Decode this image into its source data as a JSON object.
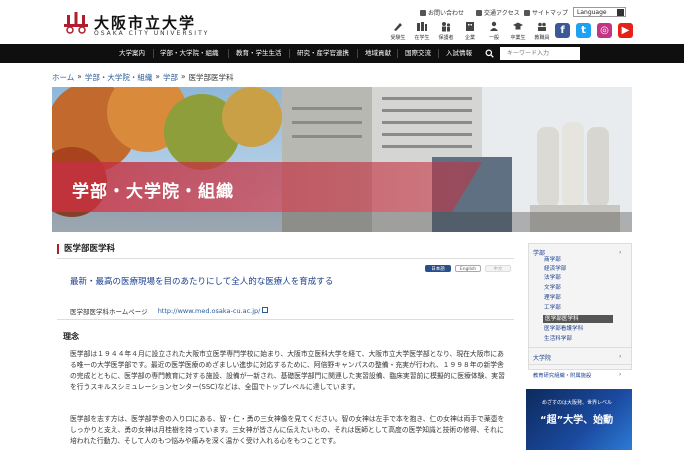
{
  "header": {
    "logo_jp": "大阪市立大学",
    "logo_en": "OSAKA CITY UNIVERSITY",
    "util_links": [
      "お問い合わせ",
      "交通アクセス",
      "サイトマップ"
    ],
    "language_select": "Language",
    "audience": [
      "受験生",
      "在学生",
      "保護者",
      "企業",
      "一般",
      "卒業生",
      "教職員"
    ],
    "sns": [
      {
        "name": "facebook",
        "glyph": "f",
        "color": "#3b5998"
      },
      {
        "name": "twitter",
        "glyph": "t",
        "color": "#1da1f2"
      },
      {
        "name": "instagram",
        "glyph": "◎",
        "color": "#c13584"
      },
      {
        "name": "youtube",
        "glyph": "▶",
        "color": "#e62117"
      }
    ]
  },
  "nav": {
    "items": [
      "大学案内",
      "学部・大学院・組織",
      "教育・学生生活",
      "研究・産学官連携",
      "地域貢献",
      "国際交流",
      "入試情報"
    ],
    "search_placeholder": "キーワード入力"
  },
  "breadcrumb": [
    "ホーム",
    "学部・大学院・組織",
    "学部",
    "医学部医学科"
  ],
  "hero": {
    "title": "学部・大学院・組織"
  },
  "main": {
    "section_title": "医学部医学科",
    "lang_buttons": [
      "日本語",
      "English",
      "中文"
    ],
    "lead": "最新・最高の医療現場を目のあたりにして全人的な医療人を育成する",
    "hp_label": "医学部医学科ホームページ",
    "hp_url": "http://www.med.osaka-cu.ac.jp/",
    "philosophy_heading": "理念",
    "paragraph1": "医学部は１９４４年４月に設立された大阪市立医学専門学校に始まり、大阪市立医科大学を経て、大阪市立大学医学部となり、現在大阪市にある唯一の大学医学部です。最近の医学医療のめざましい進歩に対応するために、阿倍野キャンパスの整備・充実が行われ、１９９８年の新学舎の完成とともに、医学部の専門教育に対する施設、設備が一新され、基礎医学部門に関連した実習設備、臨床実習前に模擬的に医療体験、実習を行うスキルスシミュレーションセンター(SSC)などは、全国でトップレベルに達しています。",
    "paragraph2": "医学部を志す方は、医学部学舎の入り口にある、智・仁・勇の三女神像を見てください。智の女神は左手で本を抱き、仁の女神は両手で薬壺をしっかりと支え、勇の女神は月桂樹を持っています。三女神が皆さんに伝えたいもの、それは医師として高度の医学知識と技術の修得、それに培われた行動力、そして人のもつ悩みや痛みを深く温かく受け入れる心をもつことです。"
  },
  "sidebar": {
    "group_faculty": "学部",
    "items": [
      "商学部",
      "経済学部",
      "法学部",
      "文学部",
      "理学部",
      "工学部",
      "医学部医学科",
      "医学部看護学科",
      "生活科学部"
    ],
    "active_index": 6,
    "group_graduate": "大学院",
    "group_institutes": "教育研究組織・附属施設",
    "banner_sub": "めざすのは大阪発、世界レベル",
    "banner_main": "“超”大学、始動"
  },
  "colors": {
    "accent": "#b01e2e",
    "nav_bg": "#0f0f0f",
    "link": "#1b3f8f"
  }
}
